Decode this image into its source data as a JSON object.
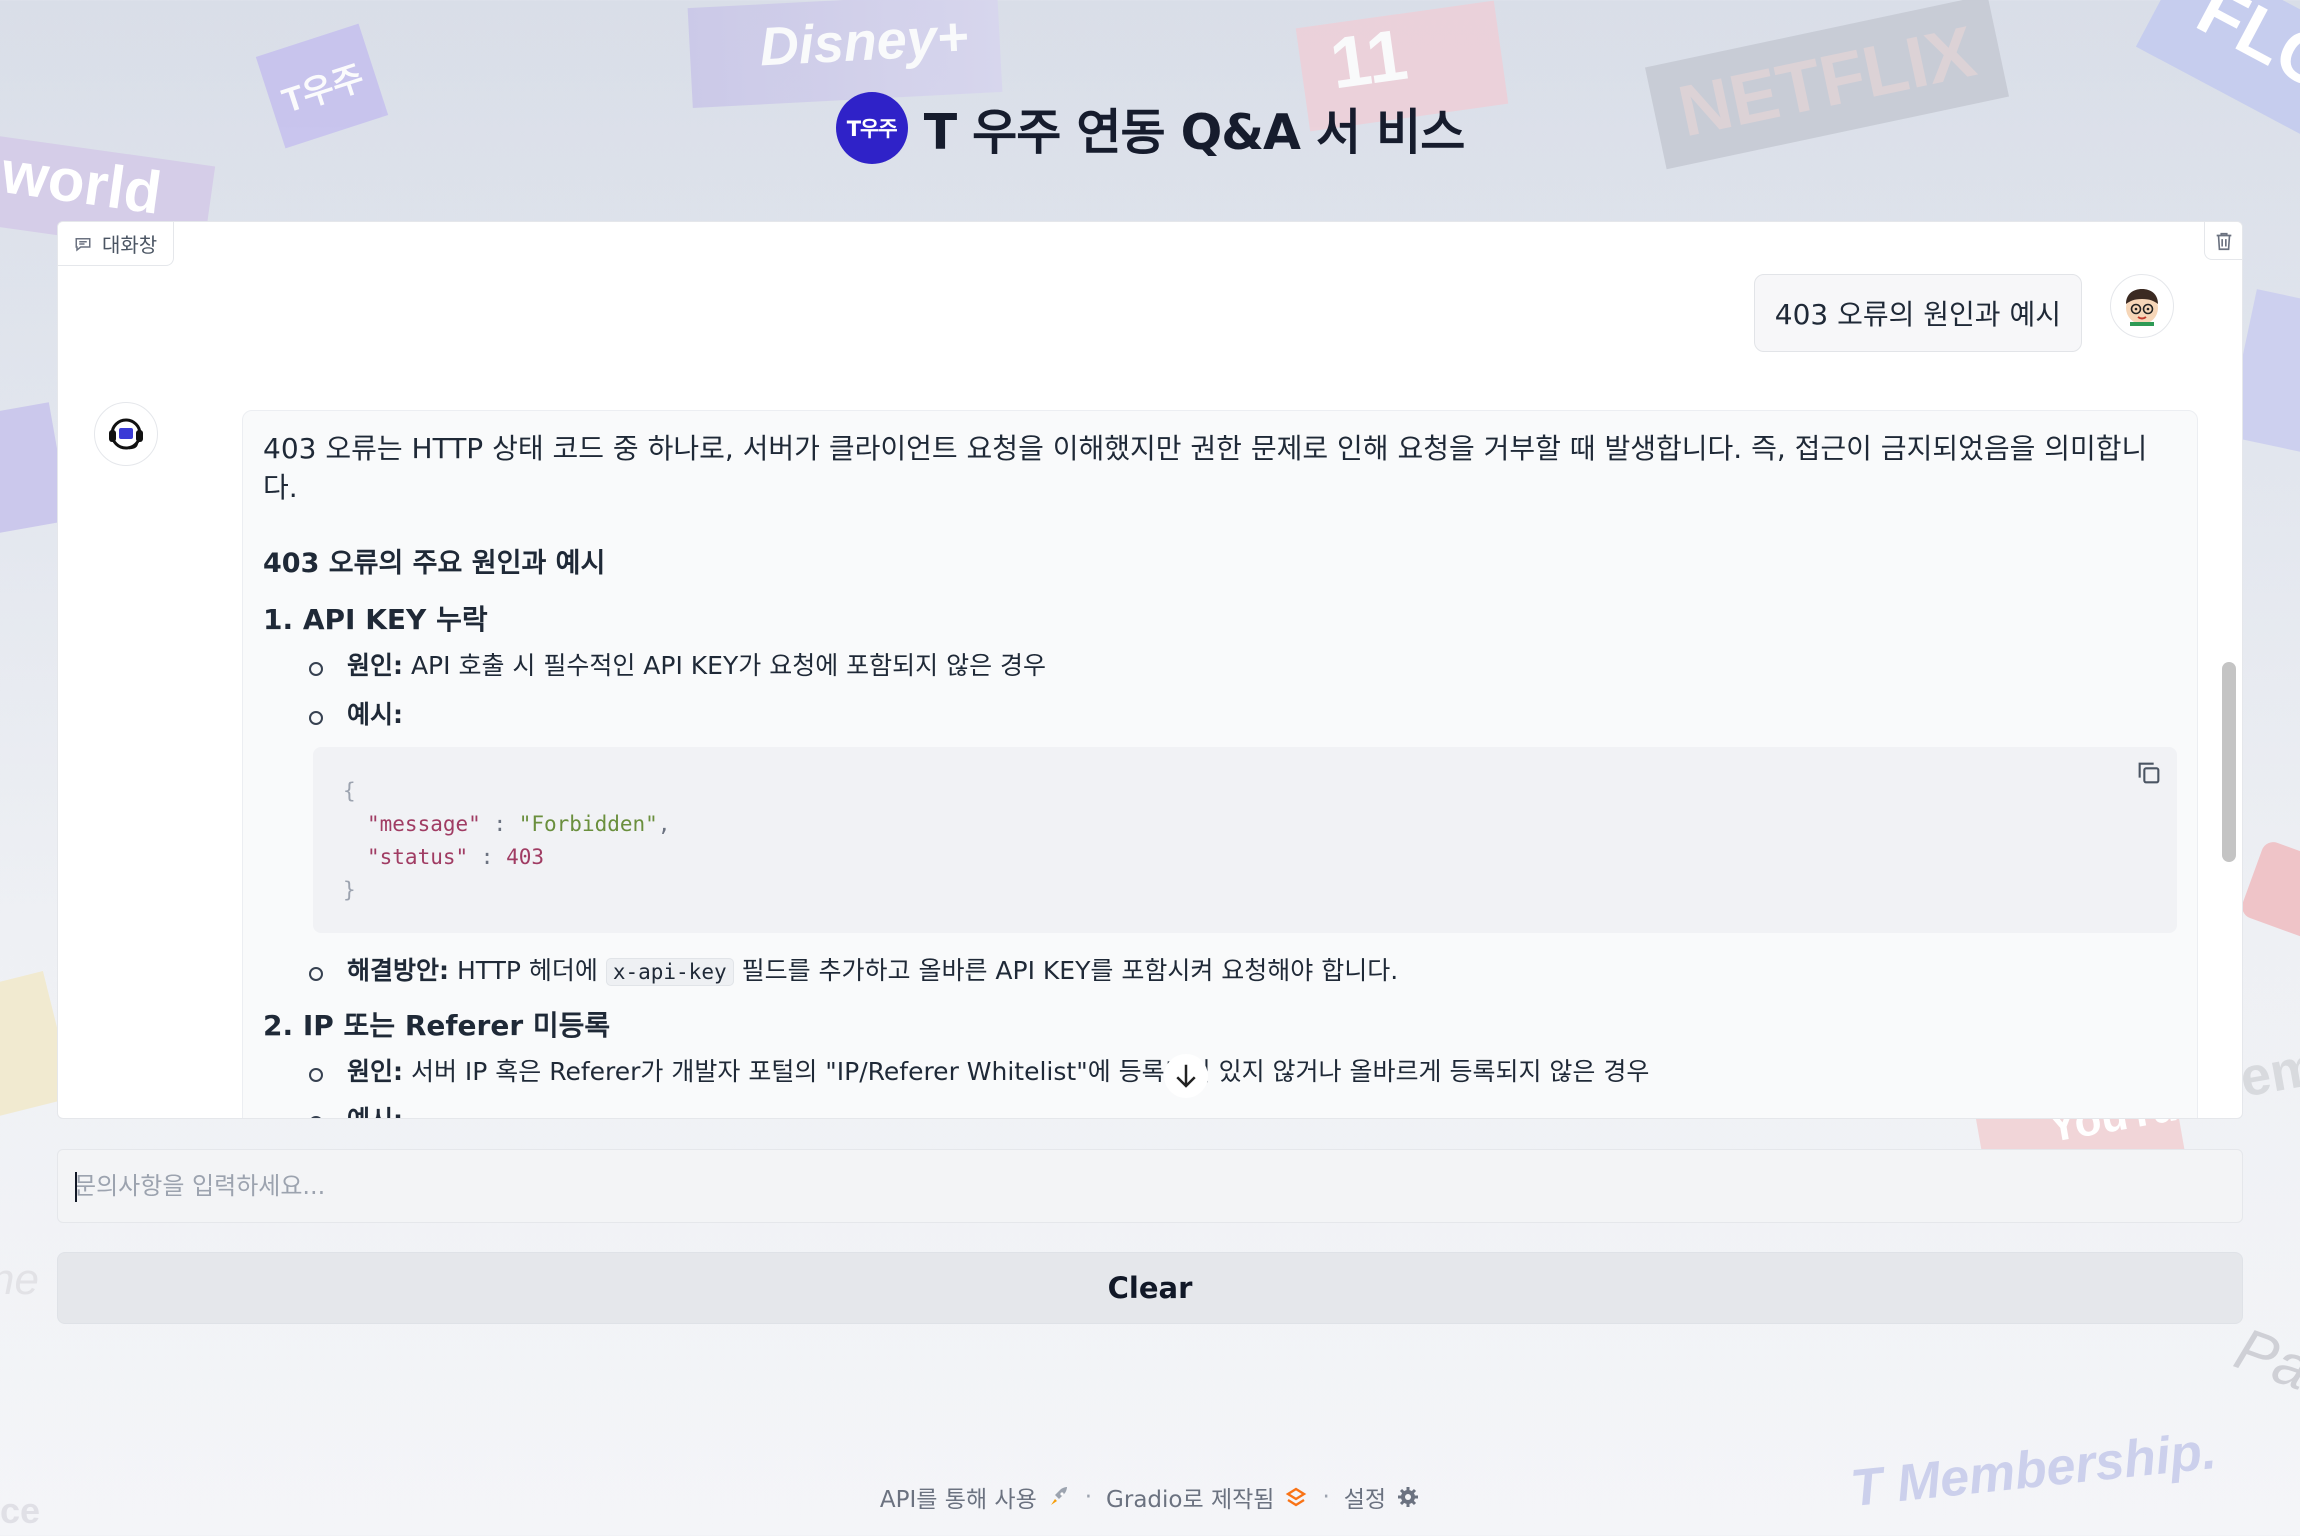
{
  "background": {
    "logos": [
      "Disney+",
      "T우주",
      "11",
      "NETFLIX",
      "FLO",
      "world",
      "YouTube",
      "ne",
      "ice",
      "emi",
      "T Membership.",
      "Pau"
    ]
  },
  "header": {
    "logo_text": "T우주",
    "title": "T 우주 연동 Q&A 서 비스"
  },
  "chat": {
    "label": "대화창",
    "label_icon": "chat-bubble-icon",
    "user_message": "403 오류의 원인과 예시",
    "bot": {
      "intro": "403 오류는 HTTP 상태 코드 중 하나로, 서버가 클라이언트 요청을 이해했지만 권한 문제로 인해 요청을 거부할 때 발생합니다. 즉, 접근이 금지되었음을 의미합니다.",
      "heading": "403 오류의 주요 원인과 예시",
      "sections": [
        {
          "title": "1. API KEY 누락",
          "cause_label": "원인:",
          "cause_text": " API 호출 시 필수적인 API KEY가 요청에 포함되지 않은 경우",
          "example_label": "예시:",
          "code": {
            "open": "{",
            "key1": "\"message\"",
            "sep": " : ",
            "val1": "\"Forbidden\"",
            "comma": ",",
            "key2": "\"status\"",
            "val2": "403",
            "close": "}"
          },
          "solution_label": "해결방안:",
          "solution_pre": " HTTP 헤더에 ",
          "solution_code": "x-api-key",
          "solution_post": " 필드를 추가하고 올바른 API KEY를 포함시켜 요청해야 합니다."
        },
        {
          "title": "2. IP 또는 Referer 미등록",
          "cause_label": "원인:",
          "cause_text": " 서버 IP 혹은 Referer가 개발자 포털의 \"IP/Referer Whitelist\"에 등록되어 있지 않거나 올바르게 등록되지 않은 경우",
          "example_label": "예시:"
        }
      ]
    }
  },
  "input": {
    "placeholder": "문의사항을 입력하세요...",
    "value": ""
  },
  "clear_button": "Clear",
  "footer": {
    "api": "API를 통해 사용",
    "api_icon": "rocket-icon",
    "sep": "·",
    "gradio": "Gradio로 제작됨",
    "gradio_icon": "gradio-logo-icon",
    "settings": "설정",
    "settings_icon": "gear-icon"
  },
  "colors": {
    "accent": "#2f22c8",
    "code_key": "#a03c63",
    "code_string": "#6a8f3d"
  }
}
